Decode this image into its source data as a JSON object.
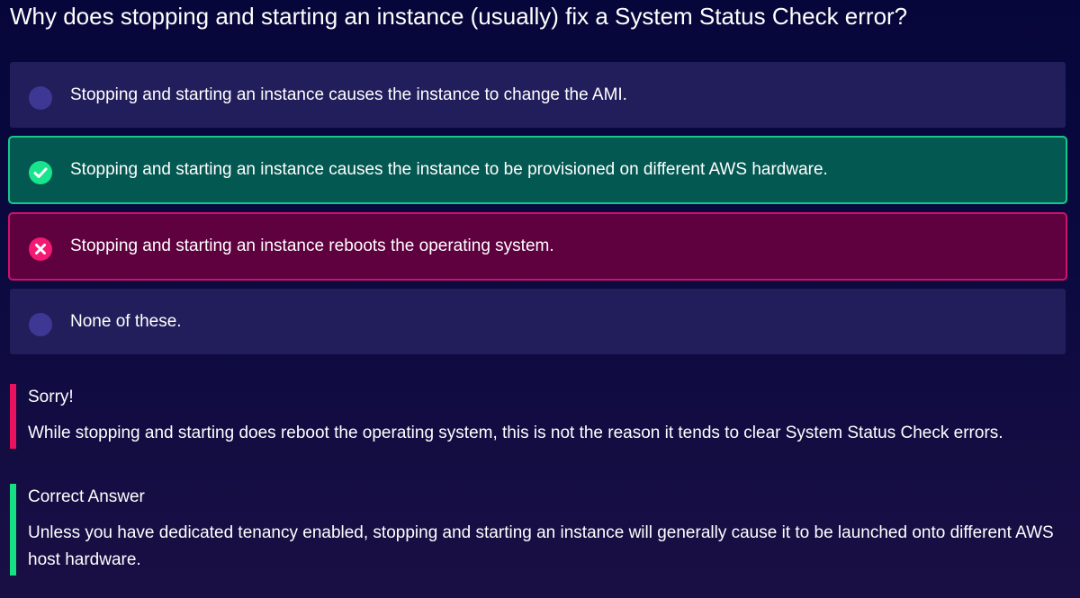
{
  "question": "Why does stopping and starting an instance (usually) fix a System Status Check error?",
  "options": [
    {
      "text": "Stopping and starting an instance causes the instance to change the AMI.",
      "state": "neutral"
    },
    {
      "text": "Stopping and starting an instance causes the instance to be provisioned on different AWS hardware.",
      "state": "correct",
      "icon": "check-circle-icon"
    },
    {
      "text": "Stopping and starting an instance reboots the operating system.",
      "state": "wrong",
      "icon": "x-circle-icon"
    },
    {
      "text": "None of these.",
      "state": "neutral"
    }
  ],
  "feedback": {
    "sorry": {
      "title": "Sorry!",
      "body": "While stopping and starting does reboot the operating system, this is not the reason it tends to clear System Status Check errors."
    },
    "correct": {
      "title": "Correct Answer",
      "body": "Unless you have dedicated tenancy enabled, stopping and starting an instance will generally cause it to be launched onto different AWS host hardware."
    }
  },
  "colors": {
    "background": "#07063a",
    "option_neutral": "#221e5c",
    "option_correct": "#045852",
    "option_correct_border": "#14c98c",
    "option_wrong": "#5f003f",
    "option_wrong_border": "#d0106b",
    "sorry_bar": "#e8125f",
    "correct_bar": "#17e084"
  }
}
